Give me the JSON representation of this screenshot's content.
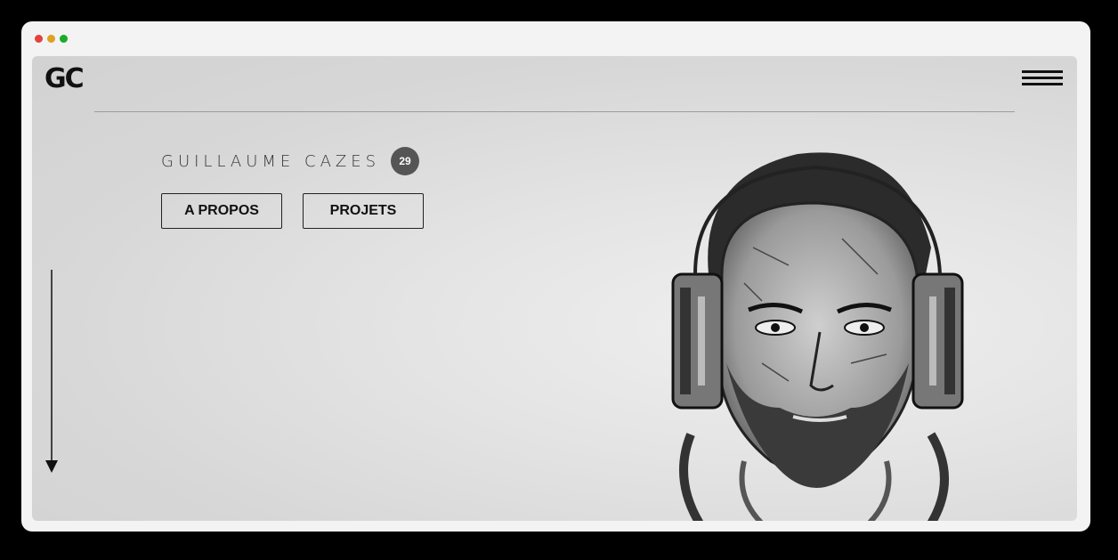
{
  "window": {
    "controls": [
      "close",
      "minimize",
      "maximize"
    ]
  },
  "header": {
    "logo": "GC",
    "menu_icon": "hamburger-menu-icon"
  },
  "hero": {
    "name": "GUILLAUME CAZES",
    "badge": "29",
    "buttons": {
      "about_label": "A PROPOS",
      "projects_label": "PROJETS"
    },
    "scroll_icon": "arrow-down-icon",
    "portrait_icon": "portrait-illustration"
  },
  "colors": {
    "background": "#d9d9d9",
    "text": "#111111",
    "badge": "#555555"
  }
}
